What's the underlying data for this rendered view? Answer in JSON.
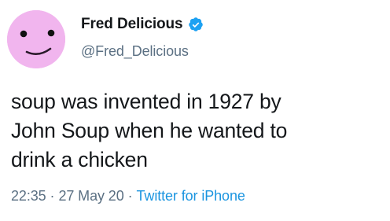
{
  "tweet": {
    "author": {
      "display_name": "Fred Delicious",
      "handle": "@Fred_Delicious",
      "verified": true,
      "avatar": "pink-smiley-face-avatar"
    },
    "text_lines": [
      "soup was invented in 1927 by",
      "John Soup when he wanted to",
      "drink a chicken"
    ],
    "time": "22:35",
    "separator": "·",
    "date": "27 May 20",
    "source": "Twitter for iPhone"
  },
  "colors": {
    "avatar_bg": "#f1b5ee",
    "verified_badge": "#1da1f2",
    "secondary_text": "#5b7083",
    "link": "#1b95e0",
    "primary_text": "#14171a"
  },
  "icons": {
    "verified": "verified-badge-icon"
  }
}
